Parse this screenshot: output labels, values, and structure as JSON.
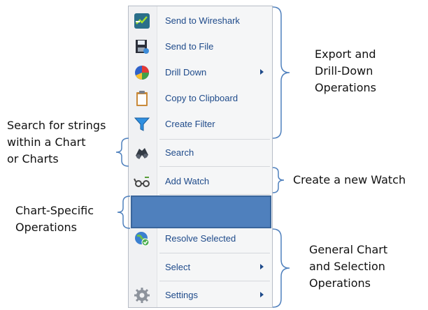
{
  "menu": {
    "items": [
      {
        "label": "Send to Wireshark",
        "icon": "wireshark-icon",
        "submenu": false
      },
      {
        "label": "Send to File",
        "icon": "save-file-icon",
        "submenu": false
      },
      {
        "label": "Drill Down",
        "icon": "pie-chart-icon",
        "submenu": true
      },
      {
        "label": "Copy to Clipboard",
        "icon": "clipboard-icon",
        "submenu": false
      },
      {
        "label": "Create Filter",
        "icon": "filter-funnel-icon",
        "submenu": false
      },
      {
        "label": "Search",
        "icon": "binoculars-icon",
        "submenu": false
      },
      {
        "label": "Add Watch",
        "icon": "watch-glasses-icon",
        "submenu": false
      },
      {
        "label": "Resolve Selected",
        "icon": "globe-resolve-icon",
        "submenu": false
      },
      {
        "label": "Select",
        "icon": "",
        "submenu": true
      },
      {
        "label": "Settings",
        "icon": "gear-icon",
        "submenu": true
      }
    ]
  },
  "annotations": {
    "export": [
      "Export and",
      "Drill-Down",
      "Operations"
    ],
    "search": [
      "Search for strings",
      "within a Chart",
      "or Charts"
    ],
    "watch": [
      "Create a new Watch"
    ],
    "chart_specific": [
      "Chart-Specific",
      "Operations"
    ],
    "general": [
      "General Chart",
      "and Selection",
      "Operations"
    ]
  },
  "colors": {
    "menu_text": "#1e4a8a",
    "highlight_fill": "#4f80bd",
    "bracket": "#4f80bd"
  }
}
